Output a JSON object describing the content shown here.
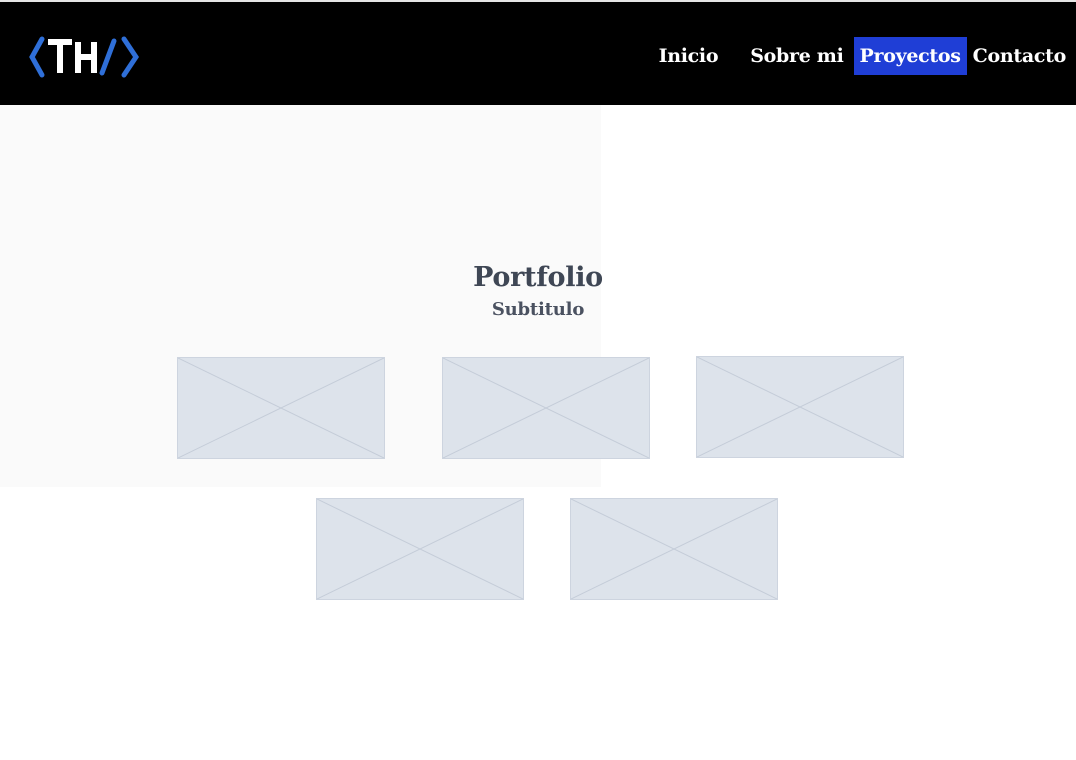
{
  "header": {
    "logo_icon": "th-code-logo",
    "nav": [
      {
        "label": "Inicio",
        "active": false
      },
      {
        "label": "Sobre mi",
        "active": false
      },
      {
        "label": "Proyectos",
        "active": true
      },
      {
        "label": "Contacto",
        "active": false
      }
    ]
  },
  "main": {
    "title": "Portfolio",
    "subtitle": "Subtitulo",
    "projects": [
      {
        "icon": "image-placeholder-icon"
      },
      {
        "icon": "image-placeholder-icon"
      },
      {
        "icon": "image-placeholder-icon"
      },
      {
        "icon": "image-placeholder-icon"
      },
      {
        "icon": "image-placeholder-icon"
      }
    ]
  },
  "colors": {
    "navbar_bg": "#000000",
    "active_nav_bg": "#1f3ed6",
    "logo_accent": "#2f6fd8",
    "heading": "#3f4755",
    "placeholder_fill": "#dde3eb"
  }
}
